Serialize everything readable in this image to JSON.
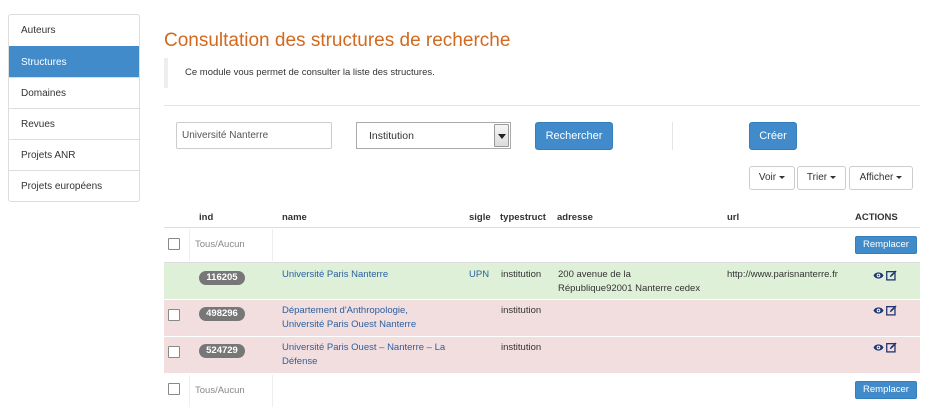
{
  "sidebar": {
    "items": [
      {
        "label": "Auteurs",
        "active": false
      },
      {
        "label": "Structures",
        "active": true
      },
      {
        "label": "Domaines",
        "active": false
      },
      {
        "label": "Revues",
        "active": false
      },
      {
        "label": "Projets ANR",
        "active": false
      },
      {
        "label": "Projets européens",
        "active": false
      }
    ]
  },
  "page": {
    "title": "Consultation des structures de recherche",
    "intro": "Ce module vous permet de consulter la liste des structures."
  },
  "toolbar": {
    "search_value": "Université Nanterre",
    "type_select": "Institution",
    "search_button": "Rechercher",
    "create_button": "Créer",
    "voir": "Voir",
    "trier": "Trier",
    "afficher": "Afficher"
  },
  "table": {
    "headers": {
      "ind": "ind",
      "name": "name",
      "sigle": "sigle",
      "typestruct": "typestruct",
      "adresse": "adresse",
      "url": "url",
      "actions": "ACTIONS"
    },
    "toggle_all": "Tous/Aucun",
    "replace_button": "Remplacer",
    "rows": [
      {
        "ind": "116205",
        "name": "Université Paris Nanterre",
        "sigle": "UPN",
        "typestruct": "institution",
        "adresse_l1": "200 avenue de la",
        "adresse_l2": "République92001 Nanterre cedex",
        "url": "http://www.parisnanterre.fr",
        "status": "success"
      },
      {
        "ind": "498296",
        "name_l1": "Département d'Anthropologie,",
        "name_l2": "Université Paris Ouest Nanterre",
        "typestruct": "institution",
        "status": "danger"
      },
      {
        "ind": "524729",
        "name_l1": "Université Paris Ouest – Nanterre – La",
        "name_l2": "Défense",
        "typestruct": "institution",
        "status": "danger"
      }
    ]
  },
  "icons": {
    "view": "eye-icon",
    "edit": "edit-icon"
  },
  "colors": {
    "primary": "#428bca",
    "title": "#d2691e",
    "success_row": "#dff0d8",
    "danger_row": "#f2dede",
    "badge": "#777777"
  }
}
